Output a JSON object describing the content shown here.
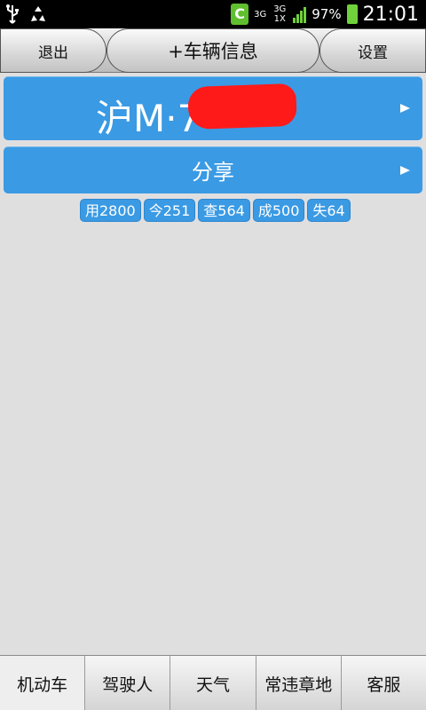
{
  "statusbar": {
    "network_label": "3G",
    "network_label2": "3G 1X",
    "battery_pct": "97%",
    "time": "21:01",
    "icons": [
      "usb-icon",
      "recycle-icon",
      "c-app-icon",
      "signal-icon",
      "battery-icon"
    ]
  },
  "header": {
    "left_button": "退出",
    "title": "+车辆信息",
    "right_button": "设置"
  },
  "plate": {
    "text": "沪M·7"
  },
  "share": {
    "label": "分享"
  },
  "chips": [
    {
      "label": "用2800"
    },
    {
      "label": "今251"
    },
    {
      "label": "查564"
    },
    {
      "label": "成500"
    },
    {
      "label": "失64"
    }
  ],
  "tabs": [
    {
      "label": "机动车",
      "active": true
    },
    {
      "label": "驾驶人",
      "active": false
    },
    {
      "label": "天气",
      "active": false
    },
    {
      "label": "常违章地",
      "active": false
    },
    {
      "label": "客服",
      "active": false
    }
  ],
  "colors": {
    "accent_blue": "#3a9ae4",
    "redaction": "#ff1a1a",
    "background": "#e0dfe0"
  }
}
